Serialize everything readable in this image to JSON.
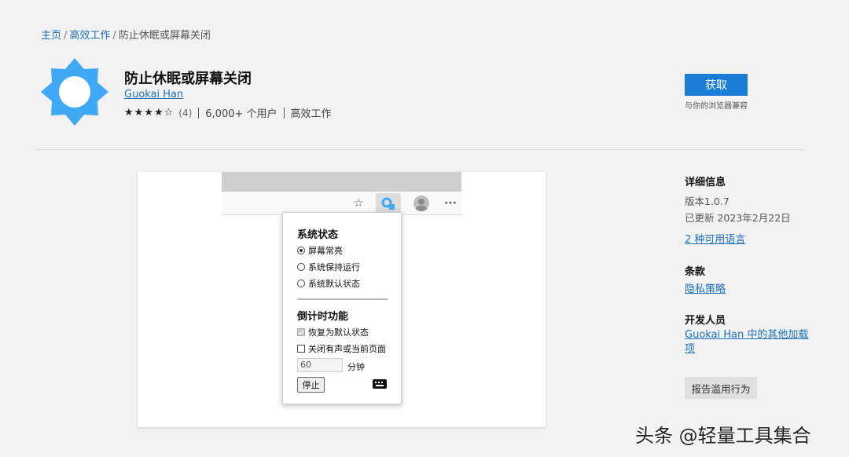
{
  "breadcrumb": {
    "home": "主页",
    "category": "高效工作",
    "current": "防止休眠或屏幕关闭",
    "separator": "/"
  },
  "app": {
    "title": "防止休眠或屏幕关闭",
    "author": "Guokai Han",
    "stars_text": "★★★★☆",
    "rating_count": "(4)",
    "users": "6,000+ 个用户",
    "category": "高效工作"
  },
  "get": {
    "label": "获取",
    "compat": "与你的浏览器兼容"
  },
  "popup": {
    "system_heading": "系统状态",
    "options": [
      "屏幕常亮",
      "系统保持运行",
      "系统默认状态"
    ],
    "timer_heading": "倒计时功能",
    "restore_label": "恢复为默认状态",
    "close_label": "关闭有声或当前页面",
    "minutes_value": "60",
    "minutes_unit": "分钟",
    "stop_label": "停止"
  },
  "browser_icons": {
    "favorite": "☆",
    "more": "···"
  },
  "details": {
    "heading": "详细信息",
    "version": "版本1.0.7",
    "updated": "已更新 2023年2月22日",
    "languages": "2 种可用语言"
  },
  "terms": {
    "heading": "条款",
    "privacy": "隐私策略"
  },
  "developer": {
    "heading": "开发人员",
    "link_line1": "Guokai Han 中的其他加载",
    "link_line2": "项"
  },
  "report": {
    "label": "报告滥用行为"
  },
  "watermark": "头条 @轻量工具集合",
  "colors": {
    "accent": "#1a7ed6",
    "link": "#1a6fb8",
    "icon": "#3fa9f5"
  }
}
